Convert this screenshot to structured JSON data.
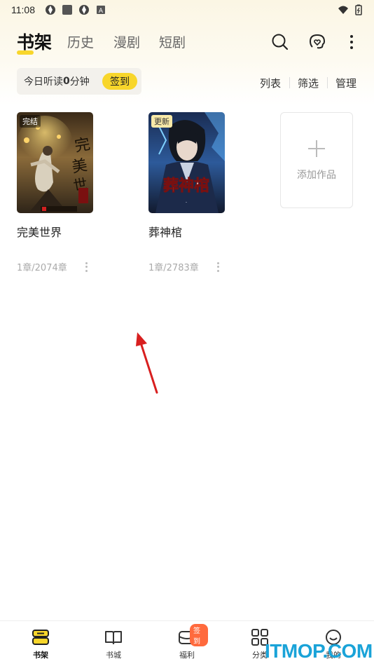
{
  "status_bar": {
    "time": "11:08"
  },
  "header": {
    "tabs": [
      {
        "label": "书架",
        "active": true
      },
      {
        "label": "历史",
        "active": false
      },
      {
        "label": "漫剧",
        "active": false
      },
      {
        "label": "短剧",
        "active": false
      }
    ],
    "icons": [
      "search-icon",
      "headphones-heart-icon",
      "more-vertical-icon"
    ]
  },
  "listen": {
    "prefix": "今日听读",
    "minutes": "0",
    "suffix": "分钟",
    "sign_label": "签到"
  },
  "actions": {
    "list": "列表",
    "filter": "筛选",
    "manage": "管理"
  },
  "books": [
    {
      "title": "完美世界",
      "badge": "完结",
      "progress": "1章/2074章",
      "cover_text": "完美世界"
    },
    {
      "title": "葬神棺",
      "badge": "更新",
      "progress": "1章/2783章",
      "cover_text": "葬神棺"
    }
  ],
  "add_card": {
    "label": "添加作品"
  },
  "bottom_nav": [
    {
      "label": "书架",
      "icon": "bookshelf-icon",
      "active": true
    },
    {
      "label": "书城",
      "icon": "open-book-icon",
      "active": false
    },
    {
      "label": "福利",
      "icon": "gift-wallet-icon",
      "active": false,
      "badge": "签到"
    },
    {
      "label": "分类",
      "icon": "grid-icon",
      "active": false
    },
    {
      "label": "我的",
      "icon": "smile-face-icon",
      "active": false
    }
  ],
  "watermark": "ITMOP.COM",
  "colors": {
    "accent": "#f8d62b",
    "badge_orange": "#ff6a3d",
    "annotation_red": "#d81f1f"
  }
}
